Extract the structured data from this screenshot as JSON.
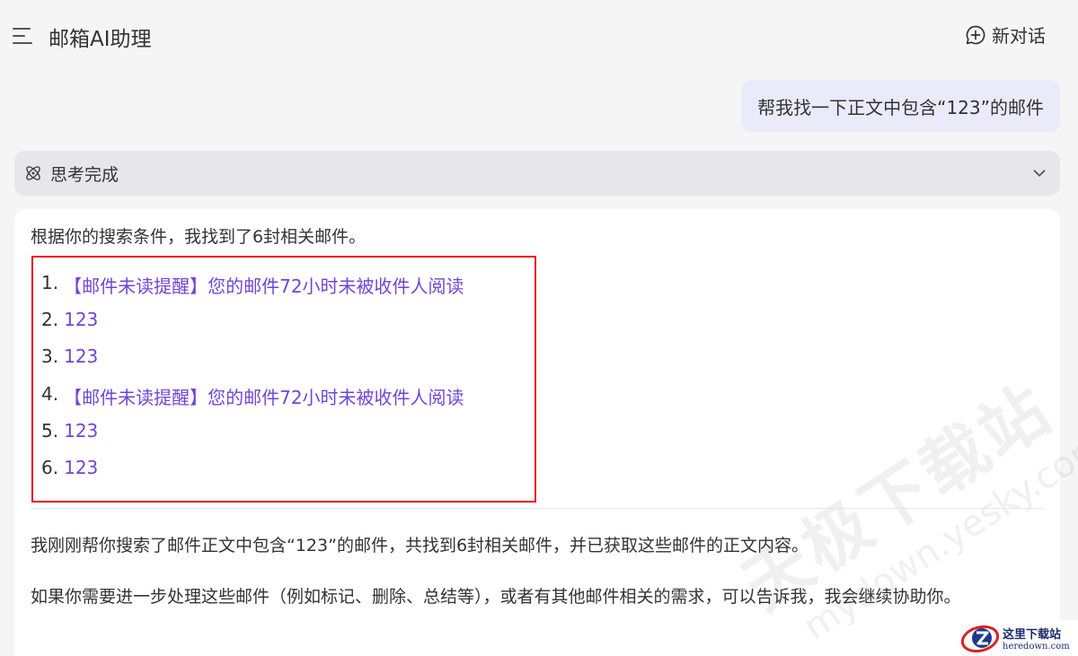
{
  "header": {
    "title": "邮箱AI助理",
    "new_chat_label": "新对话"
  },
  "user_message": "帮我找一下正文中包含“123”的邮件",
  "thinking": {
    "label": "思考完成"
  },
  "answer": {
    "intro": "根据你的搜索条件，我找到了6封相关邮件。",
    "results": [
      {
        "num": "1.",
        "title": "【邮件未读提醒】您的邮件72小时未被收件人阅读"
      },
      {
        "num": "2.",
        "title": "123"
      },
      {
        "num": "3.",
        "title": "123"
      },
      {
        "num": "4.",
        "title": "【邮件未读提醒】您的邮件72小时未被收件人阅读"
      },
      {
        "num": "5.",
        "title": "123"
      },
      {
        "num": "6.",
        "title": "123"
      }
    ],
    "summary": "我刚刚帮你搜索了邮件正文中包含“123”的邮件，共找到6封相关邮件，并已获取这些邮件的正文内容。",
    "followup": "如果你需要进一步处理这些邮件（例如标记、删除、总结等），或者有其他邮件相关的需求，可以告诉我，我会继续协助你。"
  },
  "watermark": {
    "cn": "天极下载站",
    "en": "mydown.yesky.com"
  },
  "corner_logo": {
    "cn": "这里下载站",
    "en": "heredown.com"
  },
  "colors": {
    "link": "#6f45d8",
    "highlight_border": "#e5191c",
    "user_bubble": "#ebeafa"
  }
}
